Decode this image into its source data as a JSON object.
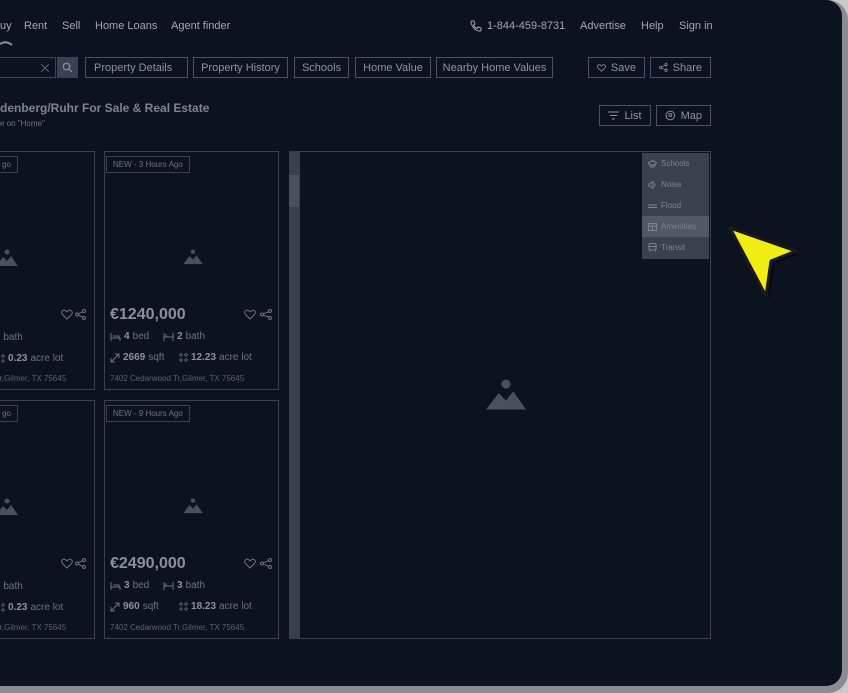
{
  "nav": {
    "buy": "uy",
    "rent": "Rent",
    "sell": "Sell",
    "home_loans": "Home Loans",
    "agent_finder": "Agent finder",
    "phone": "1-844-459-8731",
    "advertise": "Advertise",
    "help": "Help",
    "sign_in": "Sign in"
  },
  "tabs": [
    "Property Details",
    "Property History",
    "Schools",
    "Home Value",
    "Nearby Home Values"
  ],
  "actions": {
    "save": "Save",
    "share": "Share",
    "list": "List",
    "map": "Map"
  },
  "page": {
    "title": "denberg/Ruhr For Sale & Real Estate",
    "subtitle": "e on \"Home\""
  },
  "listings": [
    {
      "badge": "go",
      "baths": "2 bath",
      "lot": "0.23",
      "lot_unit": "acre lot",
      "address": "Tr,Gilmer, TX 75645"
    },
    {
      "badge": "NEW - 3 Hours Ago",
      "price": "€1240,000",
      "beds": "4",
      "beds_unit": "bed",
      "baths": "2",
      "baths_unit": "bath",
      "sqft": "2669",
      "sqft_unit": "sqft",
      "lot": "12.23",
      "lot_unit": "acre lot",
      "address": "7402 Cedarwood Tr,Gilmer, TX 75645"
    },
    {
      "badge": "go",
      "baths": "2 bath",
      "lot": "0.23",
      "lot_unit": "acre lot",
      "address": "Tr,Gilmer, TX 75645"
    },
    {
      "badge": "NEW - 9 Hours Ago",
      "price": "€2490,000",
      "beds": "3",
      "beds_unit": "bed",
      "baths": "3",
      "baths_unit": "bath",
      "sqft": "960",
      "sqft_unit": "sqft",
      "lot": "18.23",
      "lot_unit": "acre lot",
      "address": "7402 Cedarwood Tr,Gilmer, TX 75645"
    }
  ],
  "map_layers": [
    {
      "label": "Schools",
      "icon": "school-icon",
      "active": false
    },
    {
      "label": "Noise",
      "icon": "noise-icon",
      "active": false
    },
    {
      "label": "Flood",
      "icon": "flood-icon",
      "active": false
    },
    {
      "label": "Amenities",
      "icon": "amenities-icon",
      "active": true
    },
    {
      "label": "Transit",
      "icon": "transit-icon",
      "active": false
    }
  ],
  "colors": {
    "background": "#0d1220",
    "cursor": "#f2ee14"
  }
}
